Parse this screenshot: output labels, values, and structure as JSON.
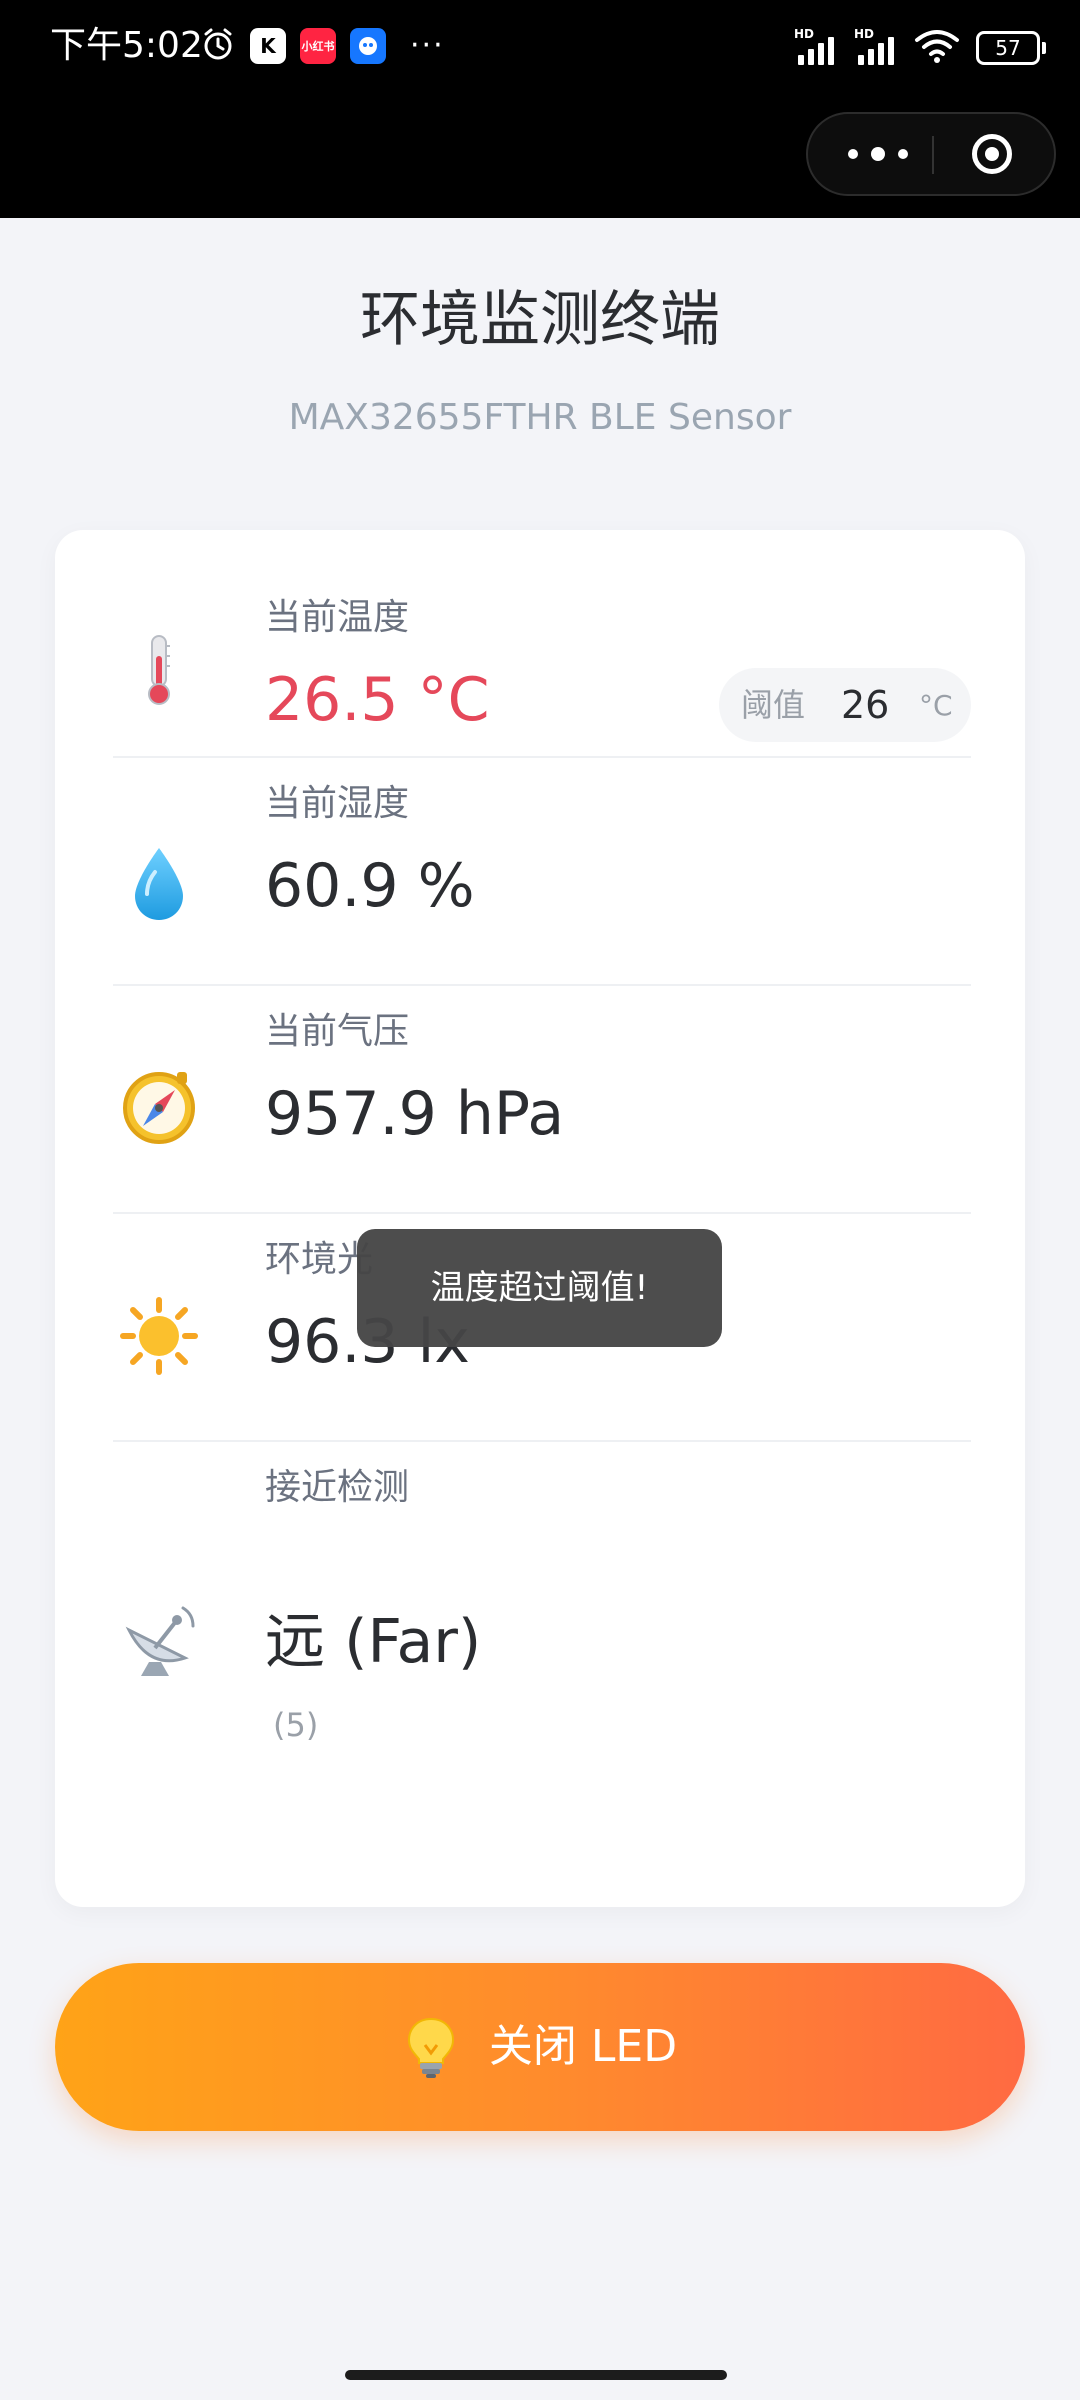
{
  "status_bar": {
    "time": "下午5:02",
    "app_badge_2": "小红书",
    "more": "···",
    "battery": "57",
    "signal_label": "HD"
  },
  "header": {
    "title": "环境监测终端",
    "subtitle": "MAX32655FTHR BLE Sensor"
  },
  "sensors": {
    "temperature": {
      "label": "当前温度",
      "value": "26.5 °C",
      "threshold_label": "阈值",
      "threshold_value": "26",
      "threshold_unit": "°C",
      "icon": "thermometer-icon"
    },
    "humidity": {
      "label": "当前湿度",
      "value": "60.9 %",
      "icon": "water-drop-icon"
    },
    "pressure": {
      "label": "当前气压",
      "value": "957.9 hPa",
      "icon": "compass-icon"
    },
    "light": {
      "label": "环境光",
      "value": "96.3 lx",
      "icon": "sun-icon"
    },
    "proximity": {
      "label": "接近检测",
      "value": "远 (Far)",
      "raw": "(5)",
      "icon": "satellite-dish-icon"
    }
  },
  "toast": {
    "message": "温度超过阈值!"
  },
  "led_button": {
    "label": "关闭 LED",
    "icon": "light-bulb-icon"
  },
  "colors": {
    "alert": "#e5485a",
    "button_gradient_start": "#ffa317",
    "button_gradient_end": "#ff6a42",
    "background": "#f3f4f8"
  }
}
